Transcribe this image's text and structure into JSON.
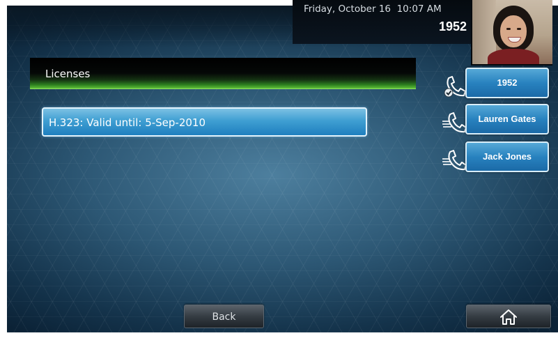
{
  "status_bar": {
    "date": "Friday, October 16",
    "time": "10:07 AM",
    "line_number": "1952"
  },
  "camera_preview": {
    "icon": "self-view-video"
  },
  "licenses": {
    "title": "Licenses",
    "items": [
      {
        "text": "H.323: Valid until: 5-Sep-2010"
      }
    ]
  },
  "line_keys": [
    {
      "label": "1952",
      "icon": "handset-registered-icon"
    },
    {
      "label": "Lauren Gates",
      "icon": "handset-speed-dial-icon"
    },
    {
      "label": "Jack Jones",
      "icon": "handset-speed-dial-icon"
    }
  ],
  "soft_keys": {
    "back_label": "Back",
    "home_icon": "home-icon"
  },
  "colors": {
    "header_green": "#2d7f1f",
    "item_blue": "#3f9fd2",
    "line_key_blue": "#2882bf",
    "background": "#2d5875"
  }
}
